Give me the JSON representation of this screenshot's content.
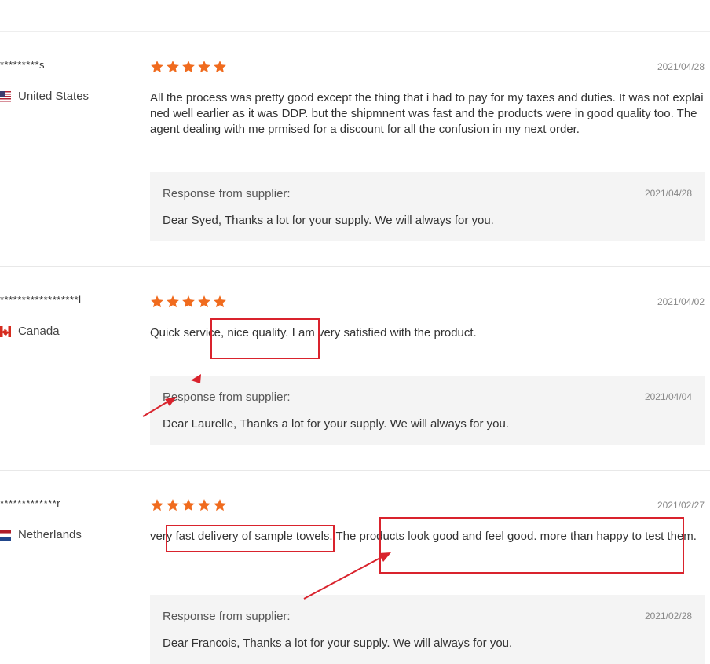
{
  "accent_color": "#f06b1e",
  "annotation_color": "#d9232d",
  "reviews": [
    {
      "reviewer": "*********s",
      "country": "United States",
      "flag_icon": "us-flag-icon",
      "rating": 5,
      "date": "2021/04/28",
      "text": "All the process was pretty good except the thing that i had to pay for my taxes and duties. It was not explained well earlier as it was DDP. but the shipmnent was fast and the products were in good quality too. The agent dealing with me prmised for a discount for all the confusion in my next order.",
      "response": {
        "label": "Response from supplier:",
        "date": "2021/04/28",
        "text": "Dear Syed, Thanks a lot for your supply. We will always for you."
      }
    },
    {
      "reviewer": "******************l",
      "country": "Canada",
      "flag_icon": "canada-flag-icon",
      "rating": 5,
      "date": "2021/04/02",
      "text": "Quick service, nice quality. I am very satisfied with the product.",
      "response": {
        "label": "Response from supplier:",
        "date": "2021/04/04",
        "text": "Dear Laurelle, Thanks a lot for your supply. We will always for you."
      }
    },
    {
      "reviewer": "*************r",
      "country": "Netherlands",
      "flag_icon": "netherlands-flag-icon",
      "rating": 5,
      "date": "2021/02/27",
      "text": "very fast delivery of sample towels. The products look good and feel good. more than happy to test them.",
      "response": {
        "label": "Response from supplier:",
        "date": "2021/02/28",
        "text": "Dear Francois, Thanks a lot for your supply. We will always for you."
      }
    }
  ]
}
